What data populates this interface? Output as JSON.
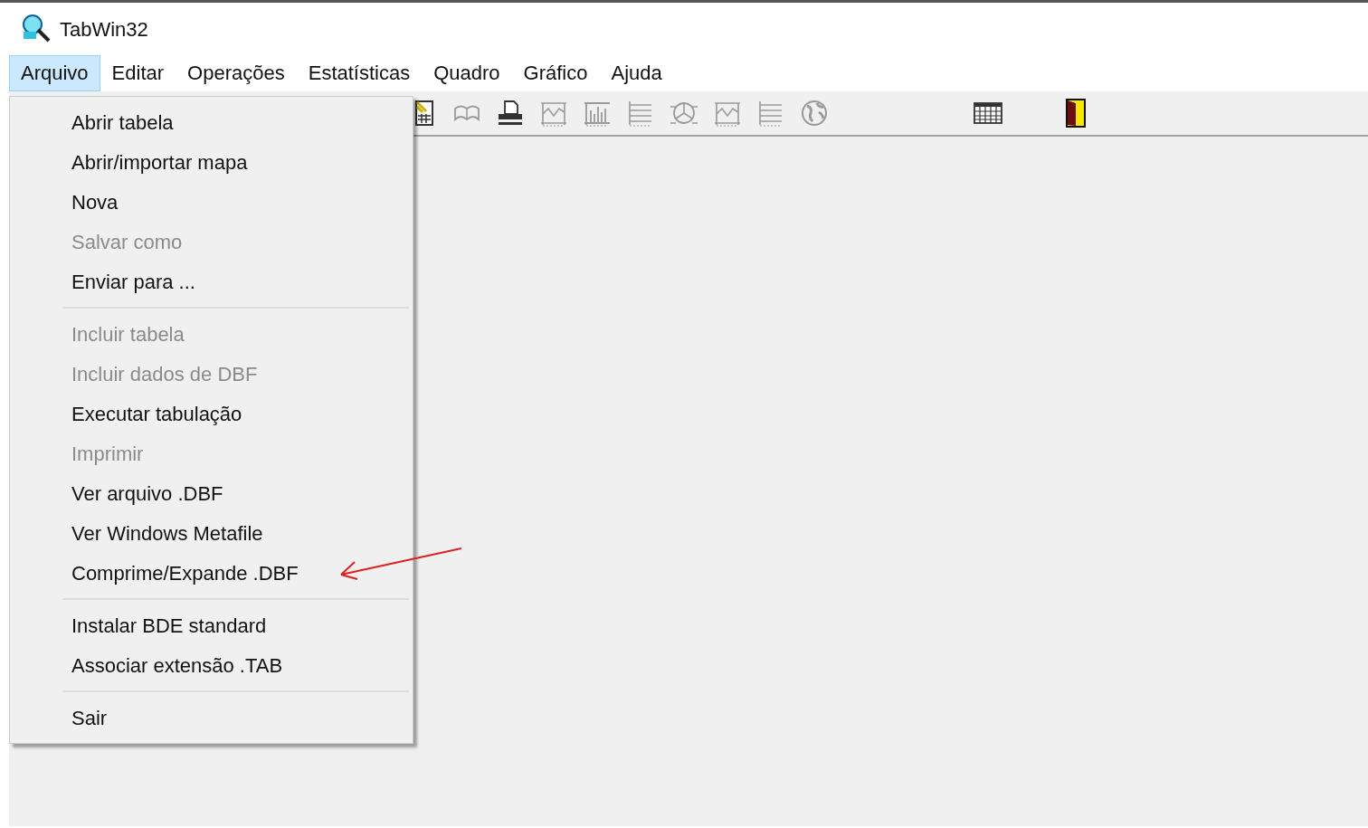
{
  "window": {
    "title": "TabWin32"
  },
  "menu_bar": [
    {
      "label": "Arquivo",
      "selected": true
    },
    {
      "label": "Editar",
      "selected": false
    },
    {
      "label": "Operações",
      "selected": false
    },
    {
      "label": "Estatísticas",
      "selected": false
    },
    {
      "label": "Quadro",
      "selected": false
    },
    {
      "label": "Gráfico",
      "selected": false
    },
    {
      "label": "Ajuda",
      "selected": false
    }
  ],
  "toolbar": {
    "groups": [
      [
        {
          "kind": "sheet",
          "disabled": false
        },
        {
          "kind": "book",
          "disabled": true
        },
        {
          "kind": "printer",
          "disabled": false
        },
        {
          "kind": "line-chart",
          "disabled": true
        },
        {
          "kind": "bar-chart",
          "disabled": true
        },
        {
          "kind": "list",
          "disabled": true
        },
        {
          "kind": "pie",
          "disabled": true
        },
        {
          "kind": "line-chart",
          "disabled": true
        },
        {
          "kind": "list",
          "disabled": true
        },
        {
          "kind": "globe",
          "disabled": true
        }
      ],
      [
        {
          "kind": "grid",
          "disabled": false
        }
      ],
      [
        {
          "kind": "door",
          "disabled": false
        }
      ]
    ]
  },
  "dropdown": {
    "groups": [
      [
        {
          "label": "Abrir tabela",
          "disabled": false
        },
        {
          "label": "Abrir/importar mapa",
          "disabled": false
        },
        {
          "label": "Nova",
          "disabled": false
        },
        {
          "label": "Salvar como",
          "disabled": true
        },
        {
          "label": "Enviar para ...",
          "disabled": false
        }
      ],
      [
        {
          "label": "Incluir tabela",
          "disabled": true
        },
        {
          "label": "Incluir dados de DBF",
          "disabled": true
        },
        {
          "label": "Executar tabulação",
          "disabled": false
        },
        {
          "label": "Imprimir",
          "disabled": true
        },
        {
          "label": "Ver arquivo .DBF",
          "disabled": false
        },
        {
          "label": "Ver Windows Metafile",
          "disabled": false
        },
        {
          "label": "Comprime/Expande .DBF",
          "disabled": false
        }
      ],
      [
        {
          "label": "Instalar BDE standard",
          "disabled": false
        },
        {
          "label": "Associar extensão .TAB",
          "disabled": false
        }
      ],
      [
        {
          "label": "Sair",
          "disabled": false
        }
      ]
    ]
  }
}
